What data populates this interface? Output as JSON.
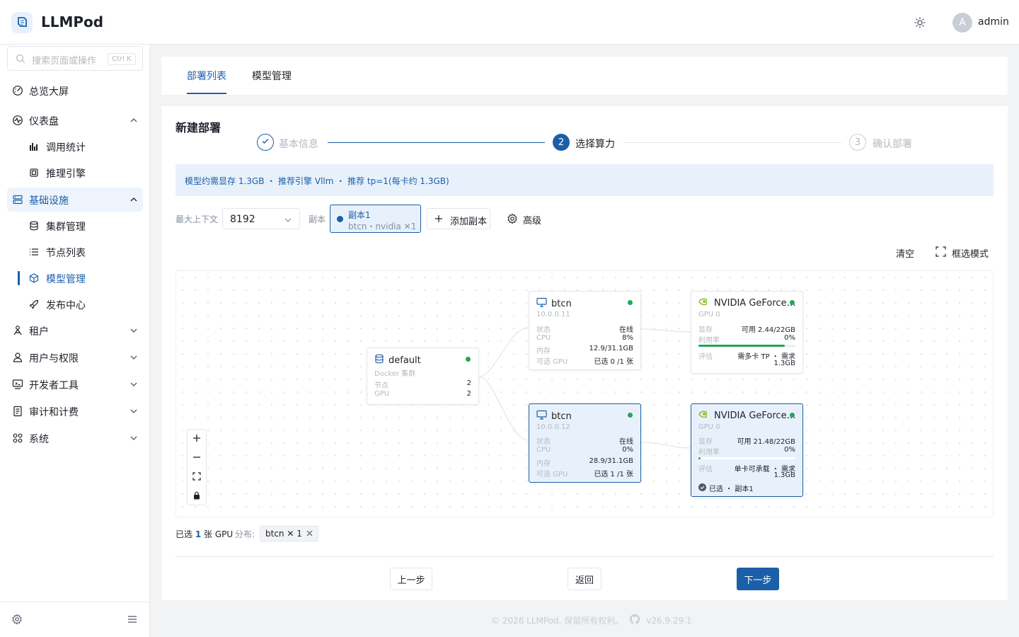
{
  "app": {
    "title": "LLMPod",
    "username": "admin",
    "avatar_letter": "A",
    "accent": "#1a5fa8"
  },
  "sidebar": {
    "search_placeholder": "搜索页面或操作",
    "shortcut": "Ctrl K",
    "items": [
      {
        "label": "总览大屏",
        "icon": "dashboard-gauge-icon"
      },
      {
        "label": "仪表盘",
        "icon": "activity-icon",
        "expanded": true,
        "children": [
          {
            "label": "调用统计",
            "icon": "bar-chart-icon"
          },
          {
            "label": "推理引擎",
            "icon": "chip-icon"
          }
        ]
      },
      {
        "label": "基础设施",
        "icon": "server-stack-icon",
        "expanded": true,
        "active": true,
        "children": [
          {
            "label": "集群管理",
            "icon": "database-icon"
          },
          {
            "label": "节点列表",
            "icon": "list-icon"
          },
          {
            "label": "模型管理",
            "icon": "cube-icon",
            "current": true
          },
          {
            "label": "发布中心",
            "icon": "rocket-icon"
          }
        ]
      },
      {
        "label": "租户",
        "icon": "tenant-icon"
      },
      {
        "label": "用户与权限",
        "icon": "user-icon"
      },
      {
        "label": "开发者工具",
        "icon": "devtools-icon"
      },
      {
        "label": "审计和计费",
        "icon": "ledger-icon"
      },
      {
        "label": "系统",
        "icon": "grid-icon"
      }
    ]
  },
  "tabs": [
    {
      "label": "部署列表",
      "active": true
    },
    {
      "label": "模型管理",
      "active": false
    }
  ],
  "page": {
    "title": "新建部署",
    "steps": [
      {
        "label": "基本信息",
        "status": "done"
      },
      {
        "label": "选择算力",
        "status": "current",
        "number": "2"
      },
      {
        "label": "确认部署",
        "status": "pending",
        "number": "3"
      }
    ],
    "info": "模型约需显存 1.3GB ・ 推荐引擎 Vllm ・ 推荐 tp=1(每卡约 1.3GB)",
    "context_label": "最大上下文",
    "context_value": "8192",
    "replica_label": "副本",
    "replica": {
      "name": "副本1",
      "detail": "btcn・nvidia ✕1"
    },
    "add_replica": "添加副本",
    "advanced": "高级",
    "clear": "清空",
    "box_select": "框选模式"
  },
  "graph": {
    "cluster": {
      "name": "default",
      "type": "Docker 集群",
      "rows": [
        {
          "k": "节点",
          "v": "2"
        },
        {
          "k": "GPU",
          "v": "2"
        }
      ]
    },
    "nodes": [
      {
        "name": "btcn",
        "ip": "10.0.0.11",
        "rows": [
          {
            "k": "状态",
            "v": "在线"
          },
          {
            "k": "CPU",
            "v": "8%"
          },
          {
            "k": "内存",
            "v": "12.9/31.1GB"
          },
          {
            "k": "可选 GPU",
            "v": "已选 0 /1 张"
          }
        ]
      },
      {
        "name": "btcn",
        "ip": "10.0.0.12",
        "rows": [
          {
            "k": "状态",
            "v": "在线"
          },
          {
            "k": "CPU",
            "v": "0%"
          },
          {
            "k": "内存",
            "v": "28.9/31.1GB"
          },
          {
            "k": "可选 GPU",
            "v": "已选 1 /1 张"
          }
        ]
      }
    ],
    "gpus": [
      {
        "name": "NVIDIA GeForce…",
        "index": "GPU 0",
        "rows": [
          {
            "k": "显存",
            "v": "可用 2.44/22GB"
          },
          {
            "k": "利用率",
            "v": "0%"
          }
        ],
        "memory_used_fraction": 0.89,
        "eval_label": "评估",
        "eval_line1": "需多卡 TP ・ 需求",
        "eval_line2": "1.3GB"
      },
      {
        "name": "NVIDIA GeForce…",
        "index": "GPU 0",
        "rows": [
          {
            "k": "显存",
            "v": "可用 21.48/22GB"
          },
          {
            "k": "利用率",
            "v": "0%"
          }
        ],
        "memory_used_fraction": 0.02,
        "eval_label": "评估",
        "eval_line1": "单卡可承载 ・ 需求",
        "eval_line2": "1.3GB",
        "selected_note": "已选 ・ 副本1"
      }
    ]
  },
  "summary": {
    "prefix": "已选",
    "count": "1",
    "suffix": "张 GPU",
    "dist_label": "分布:",
    "dist_chip": "btcn ✕ 1"
  },
  "buttons": {
    "prev": "上一步",
    "back": "返回",
    "next": "下一步"
  },
  "footer": {
    "copyright": "© 2026 LLMPod. 保留所有权利。",
    "version": "v26.9.29.1"
  }
}
